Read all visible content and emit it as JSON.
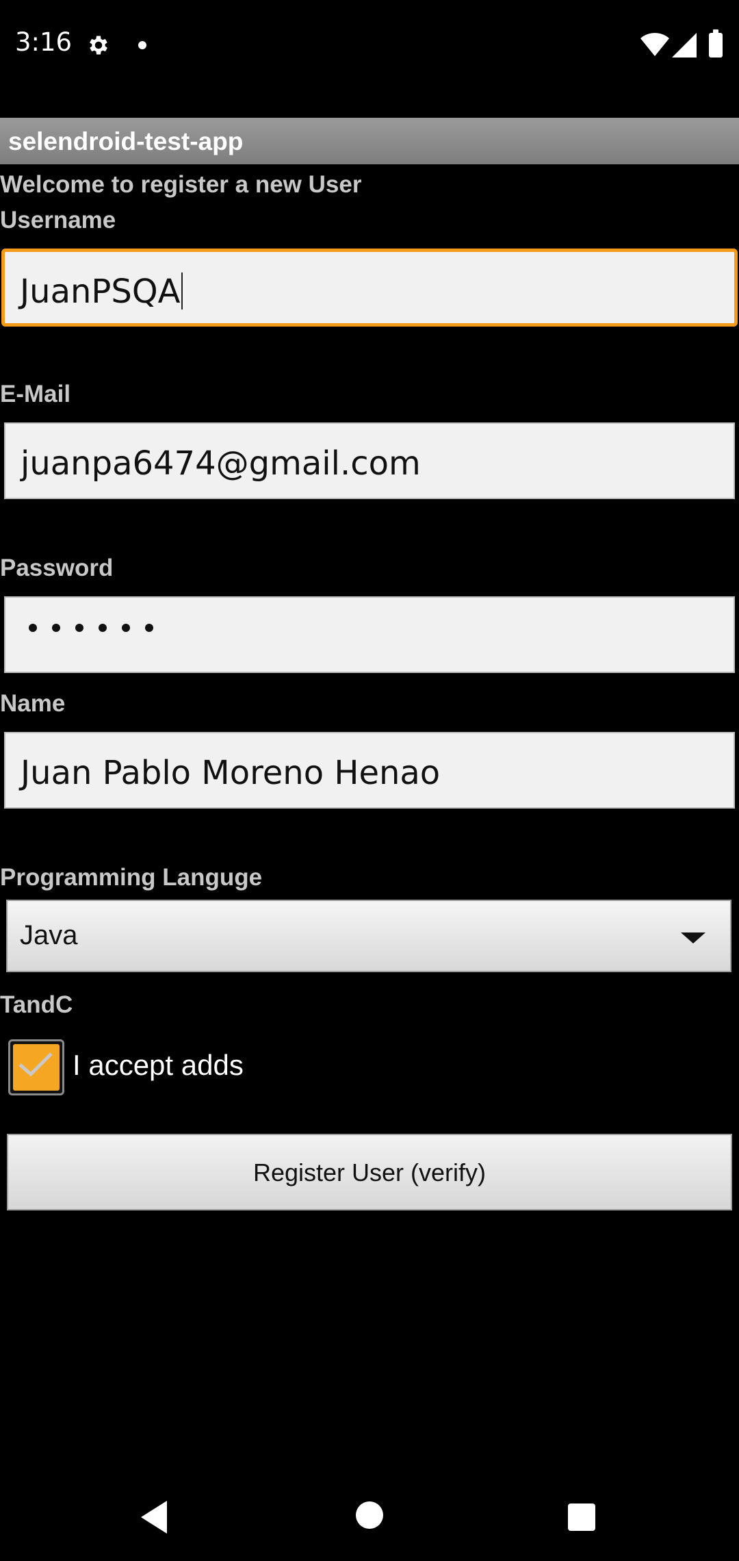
{
  "status_bar": {
    "time": "3:16",
    "icons": [
      "gear-icon",
      "notification-dot-icon",
      "wifi-icon",
      "signal-icon",
      "battery-icon"
    ]
  },
  "app": {
    "title": "selendroid-test-app"
  },
  "form": {
    "welcome": "Welcome to register a new User",
    "username": {
      "label": "Username",
      "value": "JuanPSQA"
    },
    "email": {
      "label": "E-Mail",
      "value": "juanpa6474@gmail.com"
    },
    "password": {
      "label": "Password",
      "masked_length": 6
    },
    "name": {
      "label": "Name",
      "value": "Juan Pablo Moreno Henao"
    },
    "language": {
      "label": "Programming Languge",
      "selected": "Java"
    },
    "tandc": {
      "label": "TandC",
      "checkbox_label": "I accept adds",
      "checked": true
    },
    "register_button": "Register User (verify)"
  },
  "colors": {
    "focus_border": "#f59a19",
    "checkbox_fill": "#f5a623",
    "titlebar": "#8a8a8a"
  },
  "nav_bar": {
    "icons": [
      "back-icon",
      "home-icon",
      "recents-icon"
    ]
  }
}
